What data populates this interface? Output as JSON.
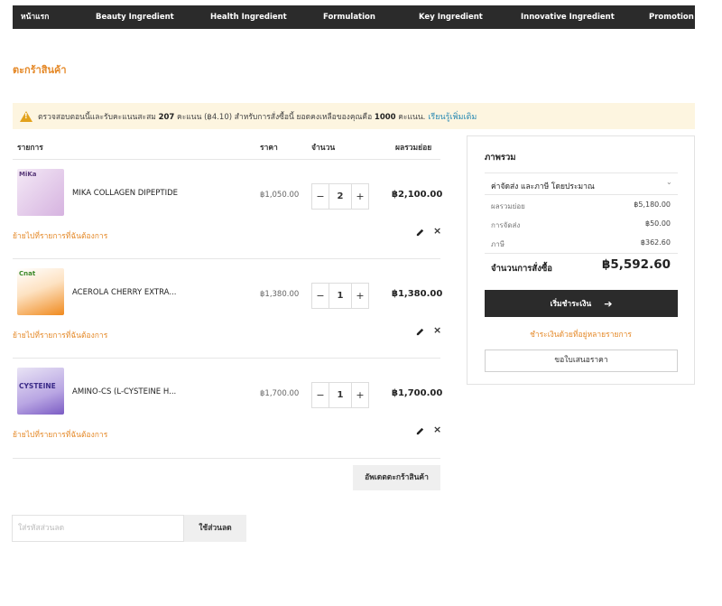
{
  "nav": {
    "items": [
      "หน้าแรก",
      "Beauty Ingredient",
      "Health Ingredient",
      "Formulation",
      "Key Ingredient",
      "Innovative Ingredient",
      "Promotion"
    ]
  },
  "page_title": "ตะกร้าสินค้า",
  "alert": {
    "text_before": "ตรวจสอบตอนนี้และรับคะแนนสะสม ",
    "points": "207",
    "text_middle": " คะแนน (฿4.10) สำหรับการสั่งซื้อนี้ ยอดคงเหลือของคุณคือ ",
    "balance": "1000",
    "text_after": " คะแนน.",
    "link": "เรียนรู้เพิ่มเติม"
  },
  "table": {
    "headers": {
      "item": "รายการ",
      "price": "ราคา",
      "qty": "จำนวน",
      "subtotal": "ผลรวมย่อย"
    },
    "rows": [
      {
        "name": "MIKA COLLAGEN DIPEPTIDE",
        "price": "฿1,050.00",
        "qty": "2",
        "subtotal": "฿2,100.00",
        "thumb_text": "MiKa",
        "wish": "ย้ายไปที่รายการที่ฉันต้องการ"
      },
      {
        "name": "ACEROLA CHERRY EXTRA...",
        "price": "฿1,380.00",
        "qty": "1",
        "subtotal": "฿1,380.00",
        "thumb_text": "Cnat",
        "wish": "ย้ายไปที่รายการที่ฉันต้องการ"
      },
      {
        "name": "AMINO-CS (L-CYSTEINE H...",
        "price": "฿1,700.00",
        "qty": "1",
        "subtotal": "฿1,700.00",
        "thumb_text": "CYSTEINE",
        "wish": "ย้ายไปที่รายการที่ฉันต้องการ"
      }
    ],
    "minus": "−",
    "plus": "+",
    "remove": "×"
  },
  "update_cart": "อัพเดตตะกร้าสินค้า",
  "coupon": {
    "placeholder": "ใส่รหัสส่วนลด",
    "button": "ใช้ส่วนลด"
  },
  "summary": {
    "title": "ภาพรวม",
    "shipping_estimate": "ค่าจัดส่ง และภาษี โดยประมาณ",
    "lines": [
      {
        "label": "ผลรวมย่อย",
        "value": "฿5,180.00"
      },
      {
        "label": "การจัดส่ง",
        "value": "฿50.00"
      },
      {
        "label": "ภาษี",
        "value": "฿362.60"
      }
    ],
    "total_label": "จำนวนการสั่งซื้อ",
    "total_value": "฿5,592.60",
    "checkout": "เริ่มชำระเงิน",
    "multi_address": "ชำระเงินด้วยที่อยู่หลายรายการ",
    "quote": "ขอใบเสนอราคา"
  },
  "colors": {
    "accent": "#e58a2a",
    "dark": "#2b2b2b",
    "link": "#2a8ab3",
    "alert_bg": "#fdf5e0"
  }
}
